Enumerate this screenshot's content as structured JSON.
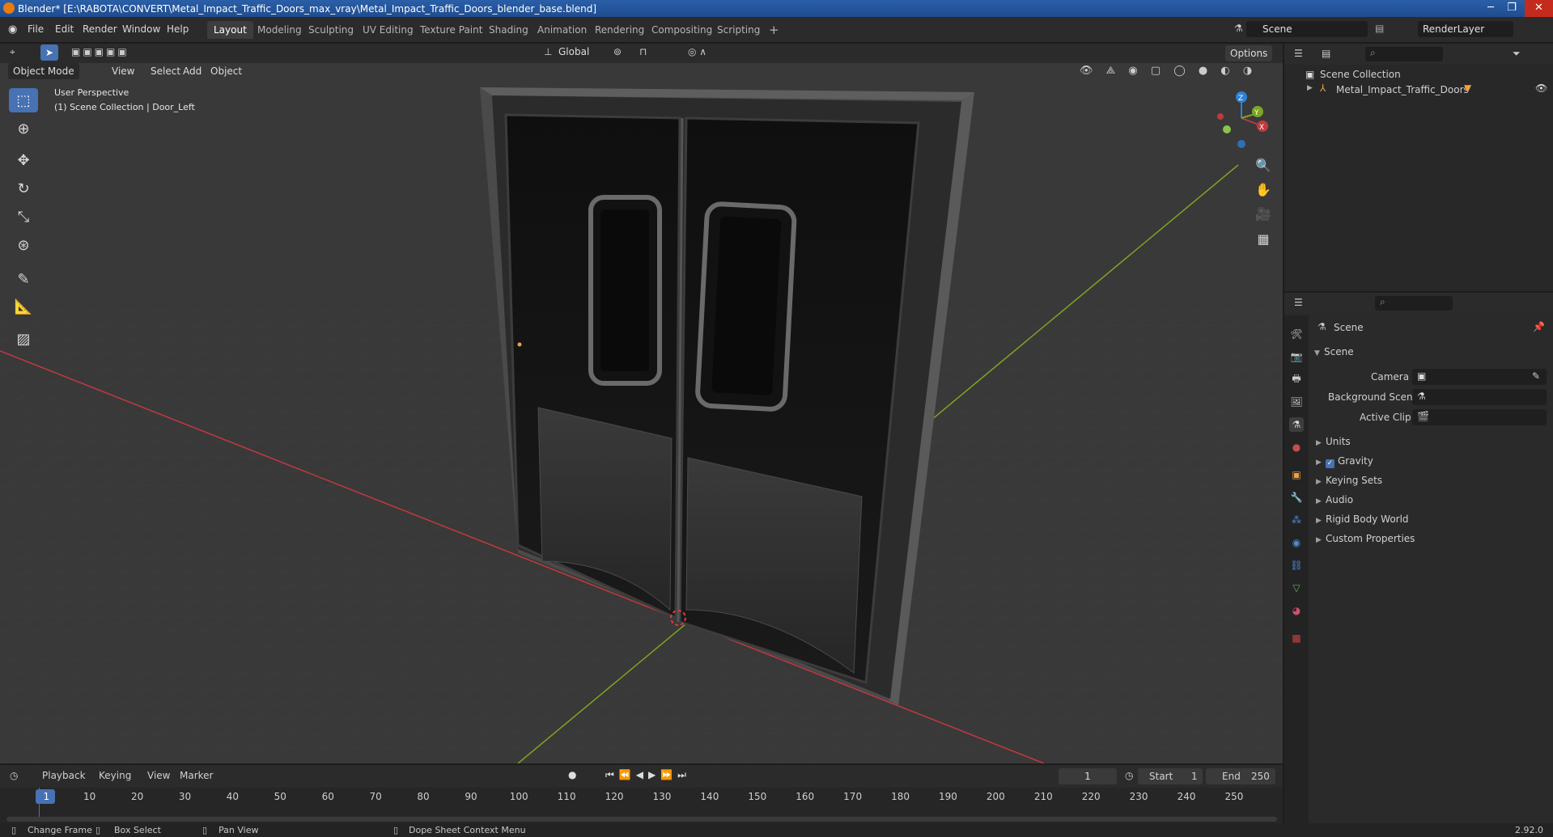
{
  "window": {
    "title": "Blender* [E:\\RABOTA\\CONVERT\\Metal_Impact_Traffic_Doors_max_vray\\Metal_Impact_Traffic_Doors_blender_base.blend]",
    "min": "─",
    "max": "❐",
    "close": "✕"
  },
  "menu": {
    "file": "File",
    "edit": "Edit",
    "render": "Render",
    "window": "Window",
    "help": "Help"
  },
  "workspaces": [
    "Layout",
    "Modeling",
    "Sculpting",
    "UV Editing",
    "Texture Paint",
    "Shading",
    "Animation",
    "Rendering",
    "Compositing",
    "Scripting"
  ],
  "add_workspace": "+",
  "scene_field": "Scene",
  "renderlayer_field": "RenderLayer",
  "toolbar": {
    "orientation": "Global",
    "options": "Options"
  },
  "viewport_header": {
    "mode": "Object Mode",
    "view": "View",
    "select": "Select",
    "add": "Add",
    "object": "Object"
  },
  "viewport_info": {
    "line1": "User Perspective",
    "line2": "(1) Scene Collection | Door_Left"
  },
  "gizmo": {
    "x": "X",
    "y": "Y",
    "z": "Z"
  },
  "outliner": {
    "root": "Scene Collection",
    "item": "Metal_Impact_Traffic_Doors"
  },
  "properties": {
    "title": "Scene",
    "section": "Scene",
    "camera_label": "Camera",
    "background_label": "Background Scene",
    "clip_label": "Active Clip",
    "panels": [
      "Units",
      "Gravity",
      "Keying Sets",
      "Audio",
      "Rigid Body World",
      "Custom Properties"
    ]
  },
  "timeline": {
    "playback": "Playback",
    "keying": "Keying",
    "view": "View",
    "marker": "Marker",
    "current_frame": "1",
    "start_label": "Start",
    "start": "1",
    "end_label": "End",
    "end": "250",
    "ticks": [
      "1",
      "10",
      "20",
      "30",
      "40",
      "50",
      "60",
      "70",
      "80",
      "90",
      "100",
      "110",
      "120",
      "130",
      "140",
      "150",
      "160",
      "170",
      "180",
      "190",
      "200",
      "210",
      "220",
      "230",
      "240",
      "250"
    ]
  },
  "status": {
    "change_frame": "Change Frame",
    "box_select": "Box Select",
    "pan_view": "Pan View",
    "context_menu": "Dope Sheet Context Menu",
    "version": "2.92.0"
  },
  "colors": {
    "accent": "#4772b3",
    "x_axis": "#c2393f",
    "y_axis": "#7da521",
    "z_axis": "#2f80d6"
  }
}
